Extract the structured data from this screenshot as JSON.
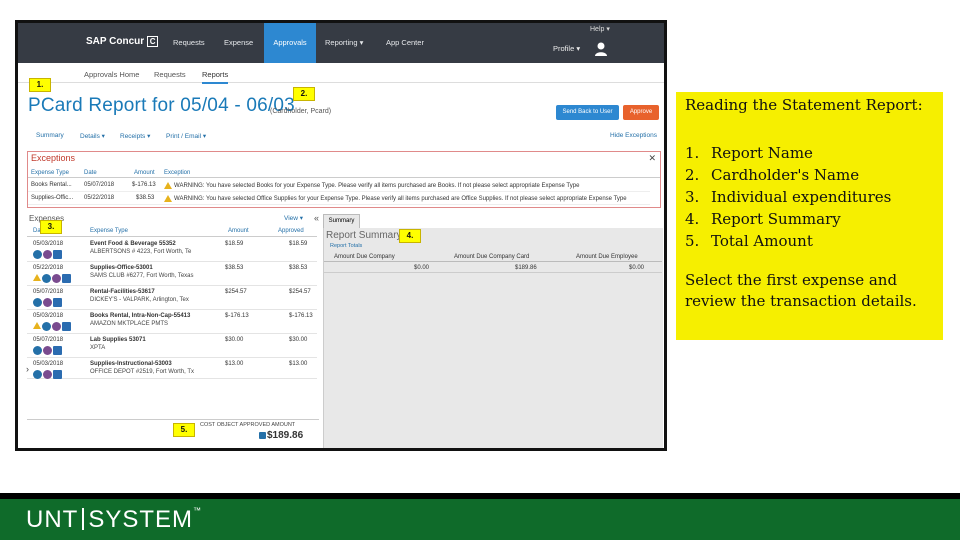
{
  "app": {
    "brand": "SAP Concur",
    "brand_mark": "C",
    "nav": [
      "Requests",
      "Expense",
      "Approvals",
      "Reporting ▾",
      "App Center"
    ],
    "help": "Help ▾",
    "profile": "Profile ▾"
  },
  "subnav": [
    "Approvals Home",
    "Requests",
    "Reports"
  ],
  "report": {
    "title": "PCard Report for 05/04 - 06/03",
    "cardholder": "(Cardholder, Pcard)",
    "send_back": "Send Back to User",
    "approve": "Approve"
  },
  "toolbar": {
    "summary": "Summary",
    "details": "Details ▾",
    "receipts": "Receipts ▾",
    "print": "Print / Email ▾",
    "hide": "Hide Exceptions"
  },
  "exceptions": {
    "title": "Exceptions",
    "close": "✕",
    "columns": [
      "Expense Type",
      "Date",
      "Amount",
      "Exception"
    ],
    "rows": [
      {
        "type": "Books Rental...",
        "date": "05/07/2018",
        "amount": "$-176.13",
        "msg": "WARNING: You have selected Books for your Expense Type. Please verify all items purchased are Books. If not please select appropriate Expense Type"
      },
      {
        "type": "Supplies-Offic...",
        "date": "05/22/2018",
        "amount": "$38.53",
        "msg": "WARNING: You have selected Office Supplies for your Expense Type. Please verify all items purchased are Office Supplies. If not please select appropriate Expense Type"
      }
    ]
  },
  "expenses": {
    "title": "Expenses",
    "view": "View ▾",
    "collapse": "«",
    "columns": [
      "Date",
      "Expense Type",
      "Amount",
      "Approved"
    ],
    "rows": [
      {
        "date": "05/03/2018",
        "type": "Event Food & Beverage 55352",
        "vendor": "ALBERTSONS # 4223, Fort Worth, Te",
        "amount": "$18.59",
        "approved": "$18.59"
      },
      {
        "date": "05/22/2018",
        "type": "Supplies-Office-53001",
        "vendor": "SAMS CLUB #6277, Fort Worth, Texas",
        "amount": "$38.53",
        "approved": "$38.53"
      },
      {
        "date": "05/07/2018",
        "type": "Rental-Facilities-53617",
        "vendor": "DICKEY'S - VALPARK, Arlington, Tex",
        "amount": "$254.57",
        "approved": "$254.57"
      },
      {
        "date": "05/03/2018",
        "type": "Books Rental, Intra-Non-Cap-55413",
        "vendor": "AMAZON MKTPLACE PMTS",
        "amount": "$-176.13",
        "approved": "$-176.13"
      },
      {
        "date": "05/07/2018",
        "type": "Lab Supplies 53071",
        "vendor": "XPTA",
        "amount": "$30.00",
        "approved": "$30.00"
      },
      {
        "date": "05/03/2018",
        "type": "Supplies-Instructional-53003",
        "vendor": "OFFICE DEPOT #2519, Fort Worth, Tx",
        "amount": "$13.00",
        "approved": "$13.00"
      }
    ]
  },
  "summary": {
    "tab": "Summary",
    "title": "Report Summary",
    "link": "Report Totals",
    "columns": [
      "Amount Due Company",
      "Amount Due Company Card",
      "Amount Due Employee"
    ],
    "values": [
      "$0.00",
      "$189.86",
      "$0.00"
    ]
  },
  "total": {
    "label": "COST OBJECT APPROVED AMOUNT",
    "amount": "$189.86"
  },
  "badges": [
    "1.",
    "2.",
    "3.",
    "4.",
    "5."
  ],
  "notes": {
    "heading": "Reading the Statement Report:",
    "items": [
      {
        "n": "1.",
        "text": "Report Name"
      },
      {
        "n": "2.",
        "text": "Cardholder's Name"
      },
      {
        "n": "3.",
        "text": "Individual expenditures"
      },
      {
        "n": "4.",
        "text": "Report Summary"
      },
      {
        "n": "5.",
        "text": "Total Amount"
      }
    ],
    "cta": "Select the first expense and review the transaction details."
  },
  "footer": {
    "left": "UNT",
    "right": "SYSTEM",
    "tm": "™"
  },
  "colors": {
    "accent": "#2d88d1",
    "approve": "#e8622c",
    "highlight": "#f6ef00",
    "brand_green": "#0f6b2a",
    "topbar": "#363b44"
  }
}
